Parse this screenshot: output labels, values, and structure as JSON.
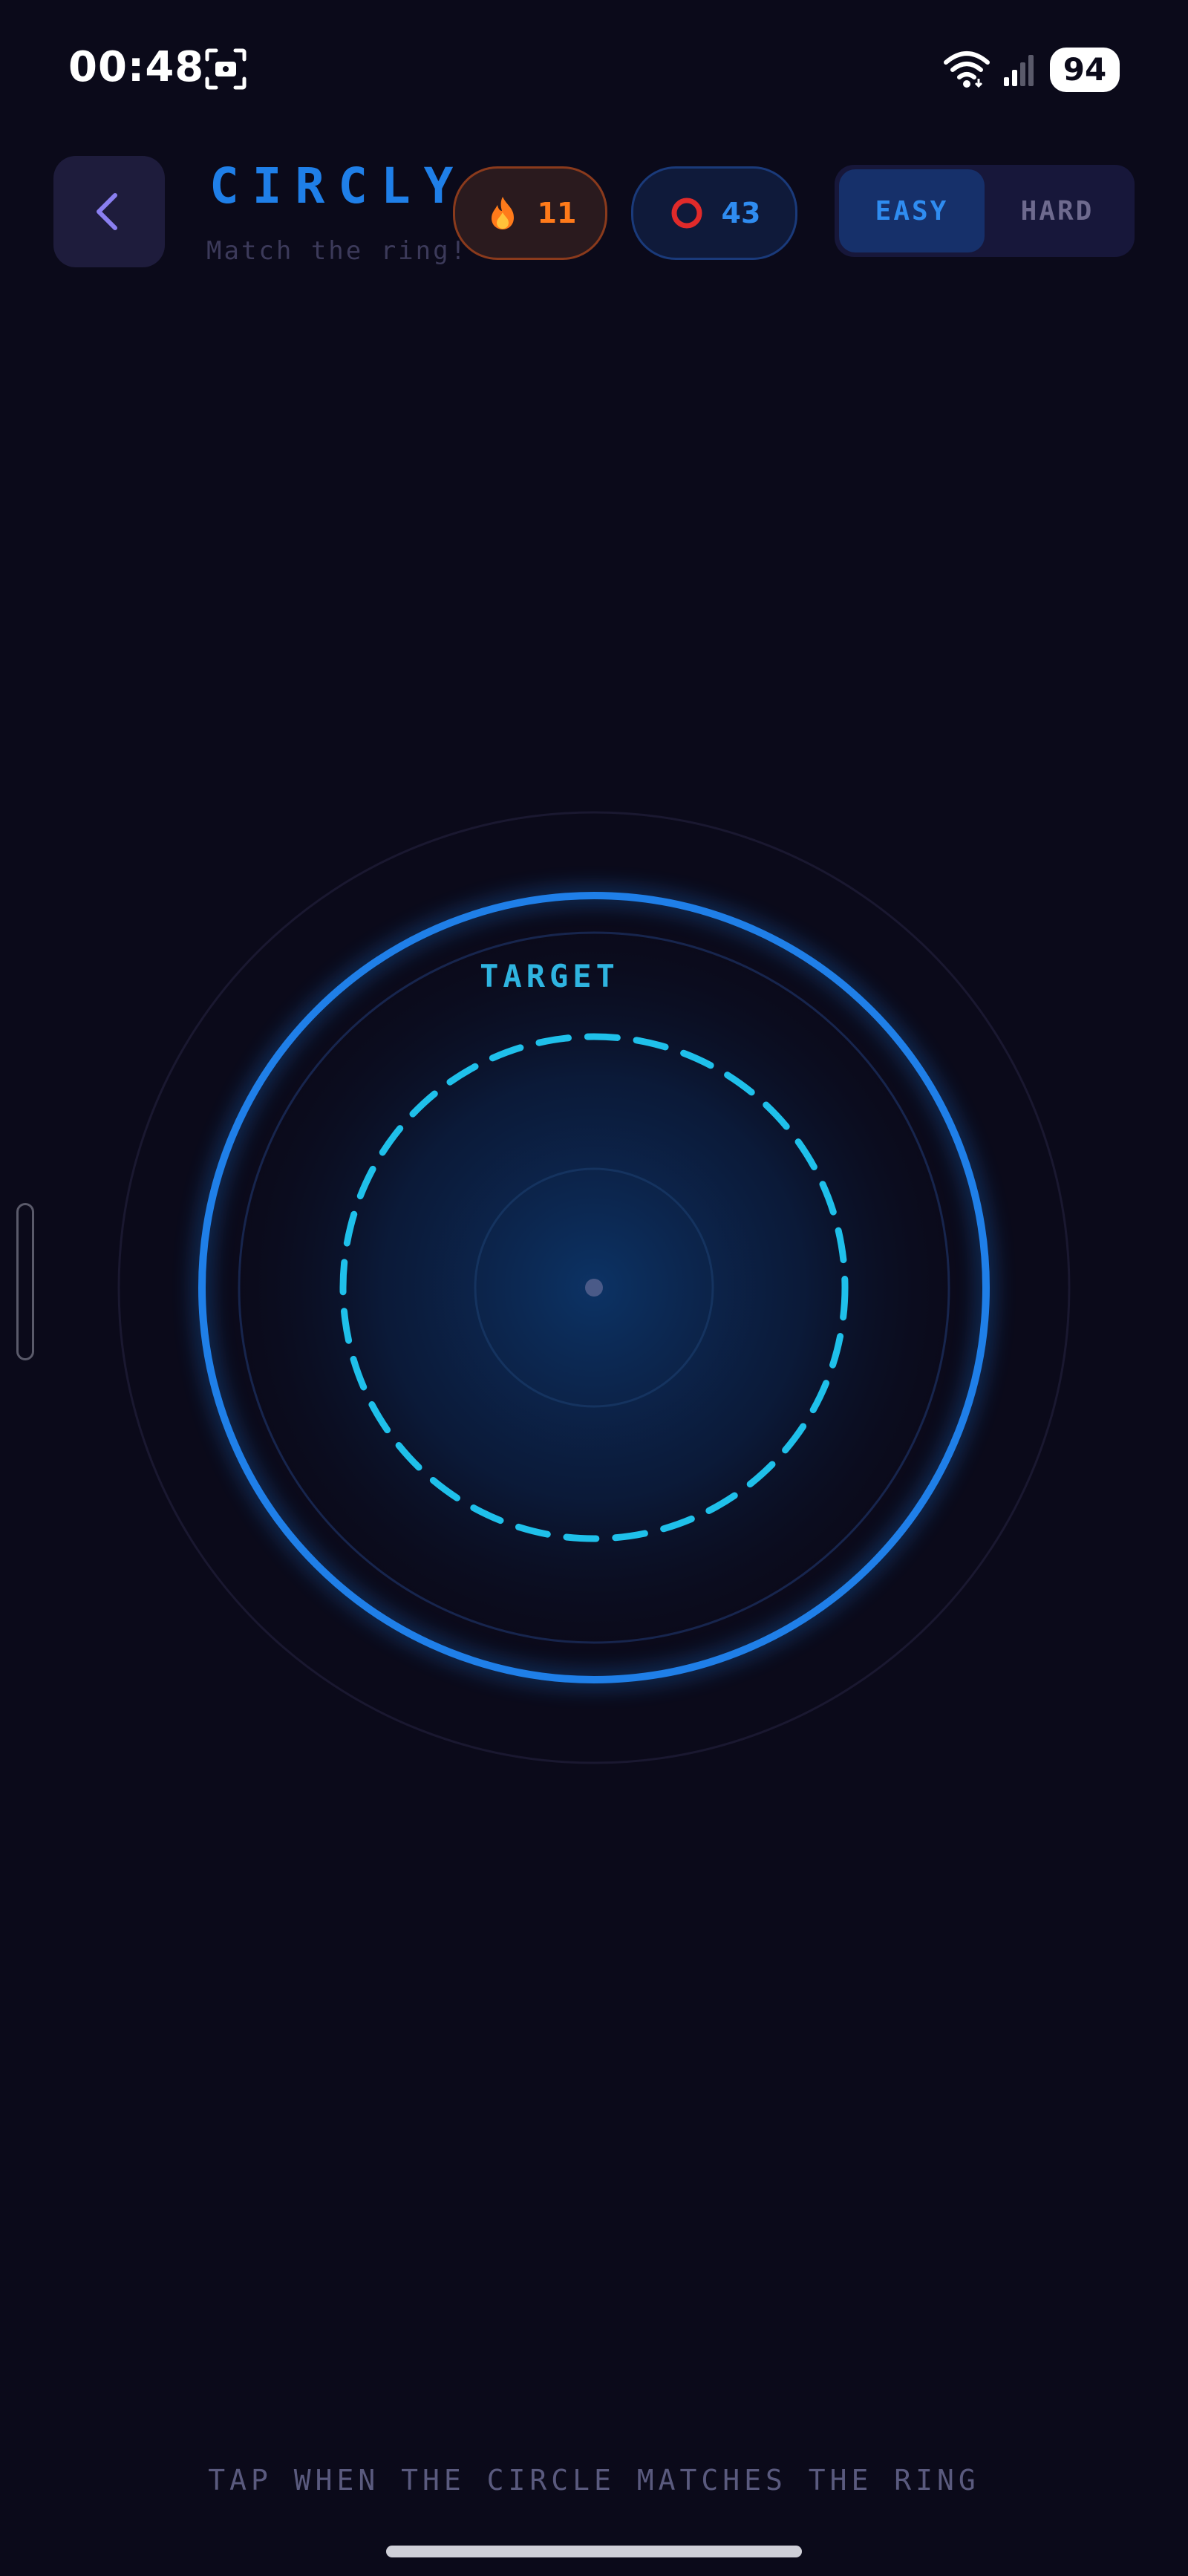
{
  "status_bar": {
    "time": "00:48",
    "battery": "94",
    "icons": [
      "screen-record-icon",
      "wifi-icon",
      "signal-icon"
    ]
  },
  "header": {
    "back_icon": "chevron-left-icon",
    "title": "CIRCLY",
    "subtitle": "Match the ring!",
    "streak": {
      "icon": "fire-icon",
      "value": "11"
    },
    "rings": {
      "icon": "ring-icon",
      "value": "43"
    },
    "mode": {
      "options": [
        "EASY",
        "HARD"
      ],
      "selected": "EASY"
    }
  },
  "game": {
    "target_label": "TARGET"
  },
  "footer": {
    "instruction": "TAP WHEN THE CIRCLE MATCHES THE RING"
  },
  "colors": {
    "background": "#0b0a1a",
    "accent_blue": "#1f7fe8",
    "target_cyan": "#1fc0ea",
    "streak_orange": "#ff7a1a",
    "ring_red": "#e02a2a"
  }
}
